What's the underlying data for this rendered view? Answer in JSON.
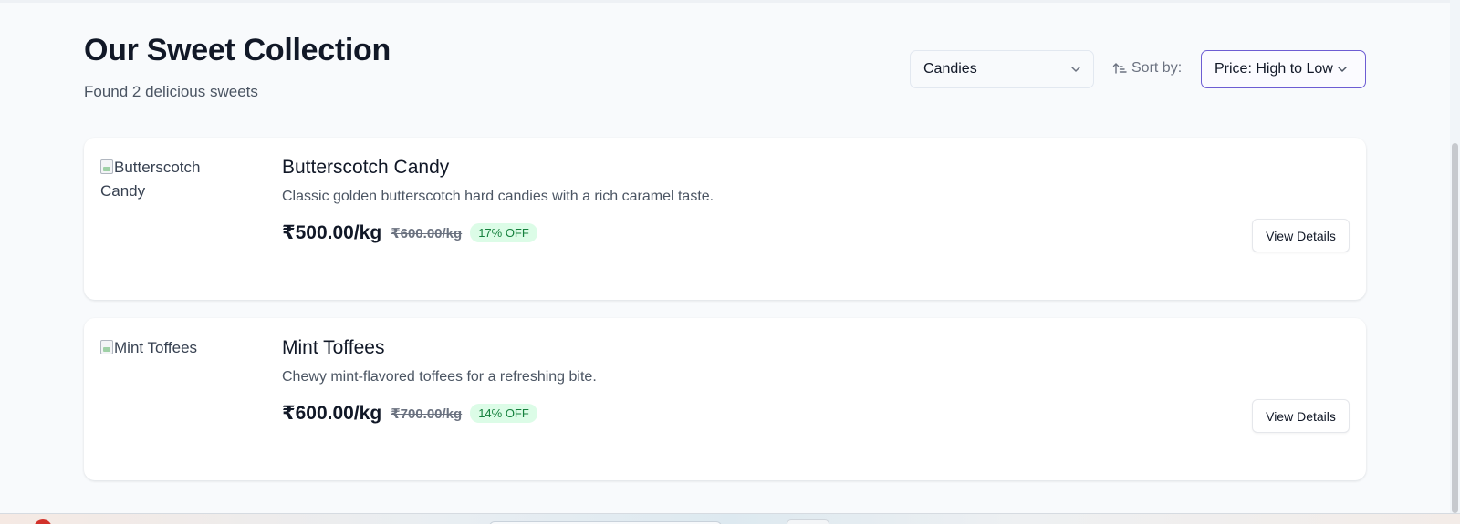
{
  "header": {
    "title": "Our Sweet Collection",
    "subtitle": "Found 2 delicious sweets"
  },
  "filters": {
    "category_value": "Candies",
    "sort_label": "Sort by:",
    "sort_value": "Price: High to Low",
    "accent_color": "#6d5dd3"
  },
  "products": [
    {
      "image_alt": "Butterscotch Candy",
      "name": "Butterscotch Candy",
      "description": "Classic golden butterscotch hard candies with a rich caramel taste.",
      "price": "₹500.00/kg",
      "original_price": "₹600.00/kg",
      "discount": "17% OFF",
      "action_label": "View Details"
    },
    {
      "image_alt": "Mint Toffees",
      "name": "Mint Toffees",
      "description": "Chewy mint-flavored toffees for a refreshing bite.",
      "price": "₹600.00/kg",
      "original_price": "₹700.00/kg",
      "discount": "14% OFF",
      "action_label": "View Details"
    }
  ],
  "icons": {
    "category_dropdown": "chevron-down-icon",
    "sort_indicator": "sort-ascending-icon",
    "sort_dropdown": "chevron-down-icon",
    "product_image": "broken-image-icon"
  }
}
